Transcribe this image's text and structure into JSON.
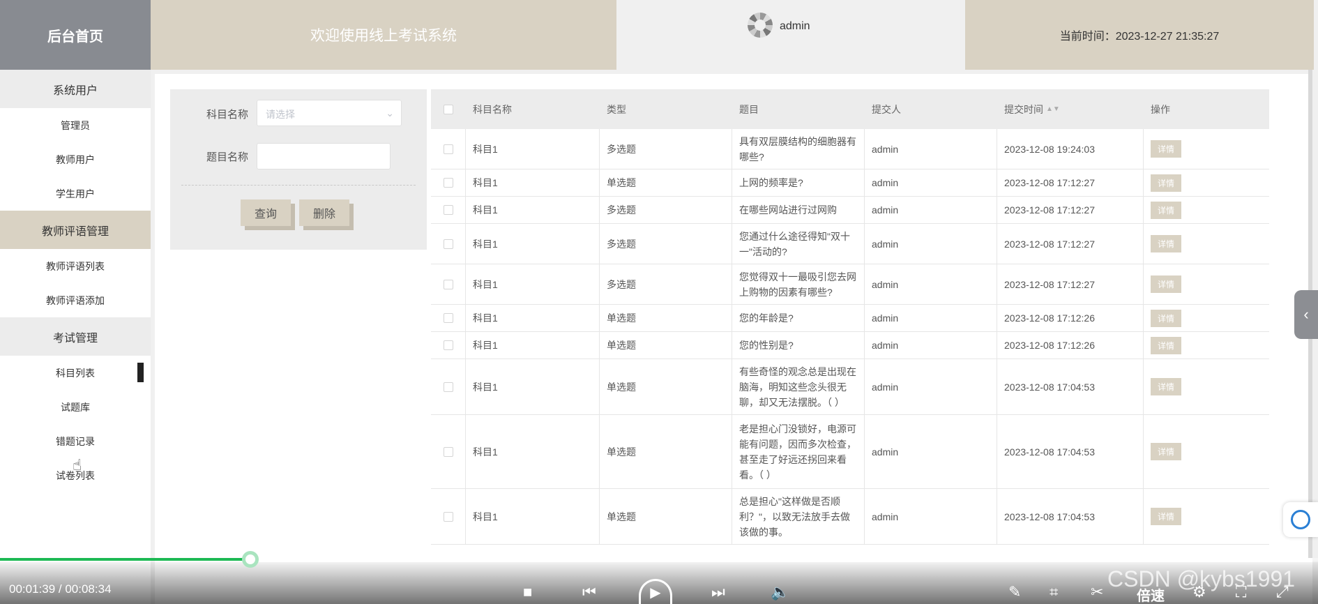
{
  "header": {
    "brand": "后台首页",
    "welcome": "欢迎使用线上考试系统",
    "username": "admin",
    "time_text": "当前时间：2023-12-27 21:35:27"
  },
  "sidebar": {
    "groups": [
      {
        "label": "系统用户",
        "items": [
          "管理员",
          "教师用户",
          "学生用户"
        ]
      },
      {
        "label": "教师评语管理",
        "items": [
          "教师评语列表",
          "教师评语添加"
        ]
      },
      {
        "label": "考试管理",
        "items": [
          "科目列表",
          "试题库",
          "错题记录",
          "试卷列表"
        ]
      }
    ]
  },
  "filter": {
    "subject_label": "科目名称",
    "subject_placeholder": "请选择",
    "question_label": "题目名称",
    "question_value": "",
    "query_button": "查询",
    "delete_button": "删除"
  },
  "table": {
    "headers": [
      "科目名称",
      "类型",
      "题目",
      "提交人",
      "提交时间",
      "操作"
    ],
    "detail_label": "详情",
    "rows": [
      {
        "subject": "科目1",
        "type": "多选题",
        "question": "具有双层膜结构的细胞器有哪些?",
        "submitter": "admin",
        "time": "2023-12-08 19:24:03"
      },
      {
        "subject": "科目1",
        "type": "单选题",
        "question": "上网的频率是?",
        "submitter": "admin",
        "time": "2023-12-08 17:12:27"
      },
      {
        "subject": "科目1",
        "type": "多选题",
        "question": "在哪些网站进行过网购",
        "submitter": "admin",
        "time": "2023-12-08 17:12:27"
      },
      {
        "subject": "科目1",
        "type": "多选题",
        "question": "您通过什么途径得知\"双十一\"活动的?",
        "submitter": "admin",
        "time": "2023-12-08 17:12:27"
      },
      {
        "subject": "科目1",
        "type": "多选题",
        "question": "您觉得双十一最吸引您去网上购物的因素有哪些?",
        "submitter": "admin",
        "time": "2023-12-08 17:12:27"
      },
      {
        "subject": "科目1",
        "type": "单选题",
        "question": "您的年龄是?",
        "submitter": "admin",
        "time": "2023-12-08 17:12:26"
      },
      {
        "subject": "科目1",
        "type": "单选题",
        "question": "您的性别是?",
        "submitter": "admin",
        "time": "2023-12-08 17:12:26"
      },
      {
        "subject": "科目1",
        "type": "单选题",
        "question": "有些奇怪的观念总是出现在脑海，明知这些念头很无聊，却又无法摆脱。（ ）",
        "submitter": "admin",
        "time": "2023-12-08 17:04:53"
      },
      {
        "subject": "科目1",
        "type": "单选题",
        "question": "老是担心门没锁好，电源可能有问题，因而多次检查，甚至走了好远还拐回来看看。（ ）",
        "submitter": "admin",
        "time": "2023-12-08 17:04:53"
      },
      {
        "subject": "科目1",
        "type": "单选题",
        "question": "总是担心\"这样做是否顺利？\"，以致无法放手去做该做的事。",
        "submitter": "admin",
        "time": "2023-12-08 17:04:53"
      }
    ]
  },
  "video": {
    "time": "00:01:39 / 00:08:34",
    "progress": 0.19,
    "speed_label": "倍速"
  },
  "watermark": "CSDN @kybs1991"
}
